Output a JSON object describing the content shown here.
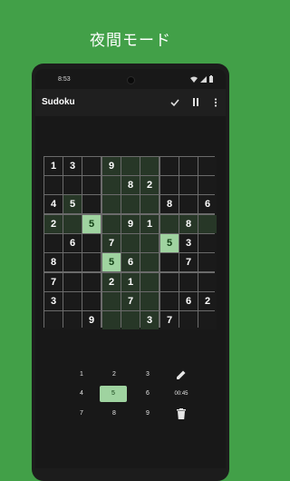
{
  "headline": "夜間モード",
  "status": {
    "time": "8:53"
  },
  "appbar": {
    "title": "Sudoku"
  },
  "board": {
    "rows": [
      [
        "1",
        "3",
        "",
        "9",
        "",
        "",
        "",
        "",
        ""
      ],
      [
        "",
        "",
        "",
        "",
        "8",
        "2",
        "",
        "",
        ""
      ],
      [
        "4",
        "5",
        "",
        "",
        "",
        "",
        "8",
        "",
        "6"
      ],
      [
        "2",
        "",
        "5",
        "",
        "9",
        "1",
        "",
        "8",
        ""
      ],
      [
        "",
        "6",
        "",
        "7",
        "",
        "",
        "5",
        "3",
        ""
      ],
      [
        "8",
        "",
        "",
        "5",
        "6",
        "",
        "",
        "7",
        ""
      ],
      [
        "7",
        "",
        "",
        "2",
        "1",
        "",
        "",
        "",
        ""
      ],
      [
        "3",
        "",
        "",
        "",
        "7",
        "",
        "",
        "6",
        "2"
      ],
      [
        "",
        "",
        "9",
        "",
        "",
        "3",
        "7",
        "",
        ""
      ]
    ],
    "highlight": [
      [
        0,
        0,
        0,
        1,
        1,
        1,
        0,
        0,
        0
      ],
      [
        0,
        0,
        0,
        1,
        1,
        1,
        0,
        0,
        0
      ],
      [
        0,
        1,
        0,
        1,
        1,
        1,
        0,
        0,
        0
      ],
      [
        1,
        1,
        2,
        1,
        1,
        1,
        1,
        1,
        1
      ],
      [
        0,
        0,
        0,
        1,
        1,
        1,
        2,
        0,
        0
      ],
      [
        0,
        0,
        0,
        2,
        1,
        1,
        0,
        0,
        0
      ],
      [
        0,
        0,
        0,
        1,
        1,
        1,
        0,
        0,
        0
      ],
      [
        0,
        0,
        0,
        1,
        1,
        1,
        0,
        0,
        0
      ],
      [
        0,
        0,
        0,
        1,
        1,
        1,
        0,
        0,
        0
      ]
    ]
  },
  "numpad": {
    "keys": [
      "1",
      "2",
      "3",
      "4",
      "5",
      "6",
      "7",
      "8",
      "9"
    ],
    "selected": "5",
    "timer": "00:45"
  },
  "icons": {
    "check": "check-icon",
    "pause": "pause-icon",
    "menu": "more-vert-icon",
    "edit": "pencil-icon",
    "delete": "trash-icon"
  },
  "colors": {
    "background": "#42a048",
    "cell": "#1a1a1a",
    "cell_highlight": "#273727",
    "cell_selected": "#9fd3a0"
  }
}
